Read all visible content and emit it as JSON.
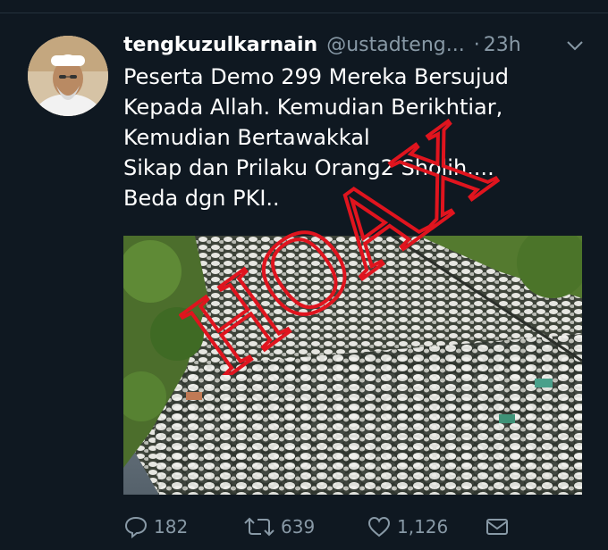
{
  "tweet": {
    "display_name": "tengkuzulkarnain",
    "handle": "@ustadteng...",
    "separator": "·",
    "time": "23h",
    "text_lines": [
      "Peserta Demo 299 Mereka Bersujud",
      "Kepada Allah. Kemudian Berikhtiar,",
      "Kemudian Bertawakkal",
      "Sikap dan Prilaku Orang2 Sholih....",
      "Beda dgn PKI.."
    ],
    "stamp_text": "HOAX",
    "stamp_color": "#e0141e",
    "avatar_icon": "user-avatar-photo",
    "menu_icon": "chevron-down-icon"
  },
  "actions": {
    "reply_count": "182",
    "retweet_count": "639",
    "like_count": "1,126",
    "reply_icon": "reply-icon",
    "retweet_icon": "retweet-icon",
    "like_icon": "heart-icon",
    "message_icon": "envelope-icon"
  },
  "colors": {
    "background": "#0f1821",
    "text": "#ffffff",
    "muted": "#8899a6",
    "stamp": "#e0141e"
  }
}
